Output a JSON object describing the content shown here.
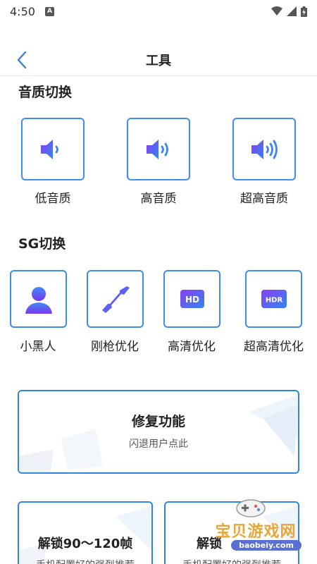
{
  "status_bar": {
    "time": "4:50",
    "notif_letter": "A"
  },
  "header": {
    "title": "工具"
  },
  "audio": {
    "section_title": "音质切换",
    "items": [
      {
        "label": "低音质",
        "icon": "speaker-low-icon"
      },
      {
        "label": "高音质",
        "icon": "speaker-medium-icon"
      },
      {
        "label": "超高音质",
        "icon": "speaker-high-icon"
      }
    ]
  },
  "sg": {
    "section_title": "SG切换",
    "items": [
      {
        "label": "小黑人",
        "icon": "person-silhouette-icon"
      },
      {
        "label": "刚枪优化",
        "icon": "rifle-icon"
      },
      {
        "label": "高清优化",
        "icon": "hd-badge-icon",
        "badge": "HD"
      },
      {
        "label": "超高清优化",
        "icon": "hdr-badge-icon",
        "badge": "HDR"
      }
    ]
  },
  "repair_card": {
    "title": "修复功能",
    "subtitle": "闪退用户点此"
  },
  "unlock_cards": [
    {
      "title": "解锁90～120帧",
      "subtitle": "手机配置好的强烈推荐"
    },
    {
      "title": "解锁",
      "subtitle": "手机配置好的强烈推荐"
    }
  ],
  "watermark": {
    "text": "宝贝游戏网",
    "url": "baobeiy.com"
  },
  "colors": {
    "accent": "#3d8ee8",
    "icon_gradient_start": "#7b3ff2",
    "icon_gradient_end": "#2f7ef0"
  }
}
